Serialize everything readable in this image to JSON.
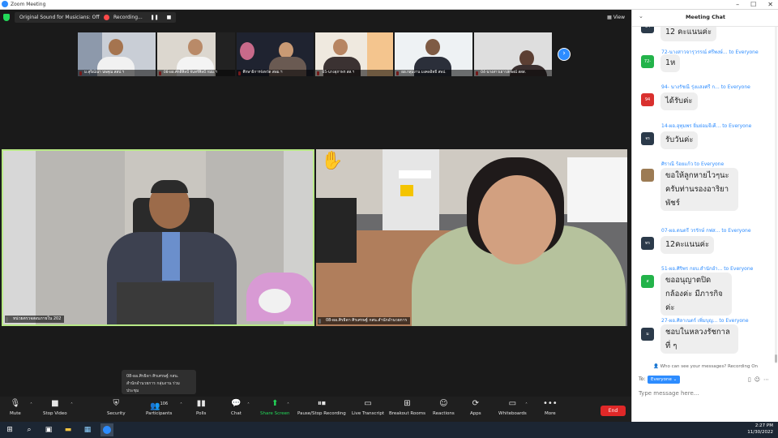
{
  "window": {
    "title": "Zoom Meeting",
    "minimize": "–",
    "maximize": "☐",
    "close": "✕"
  },
  "topbar": {
    "sound_label": "Original Sound for Musicians: Off",
    "recording_label": "Recording...",
    "pause_glyph": "❚❚",
    "stop_glyph": "■",
    "view_label": "View"
  },
  "strip": {
    "next_glyph": "›",
    "thumbs": [
      {
        "name": "ม.สุจิณ์ณา นพคุณ สสป.ฯ"
      },
      {
        "name": "08-ผอ.ศักดิ์ศิลป์ จันทร์ศิลป์ กมม.ฯ"
      },
      {
        "name": "ศึกษาธิการจังหวัด สพม.ฯ"
      },
      {
        "name": "05-นางสุภาพร สส.ฯ"
      },
      {
        "name": "ผอ.กลุ่มงาน มงคลอิทธิ์ สพป."
      },
      {
        "name": "04-นางสาวเยาวลักษณ์ สสส."
      }
    ]
  },
  "main_tiles": {
    "left_name": "หน่วยตรวจสอบภายใน 202",
    "right_name": "08-ผอ.ศิรธิดา ศิรเศรษฐ์ กสน.สำนักอำนวยการ"
  },
  "popup": {
    "line1": "08-ผอ.ศิรธิดา ศิรเศรษฐ์ กสน.",
    "line2": "สำนักอำนวยการ กลุ่มงาน ร่วมประชุม"
  },
  "toolbar": {
    "mute": "Mute",
    "stop_video": "Stop Video",
    "security": "Security",
    "participants": "Participants",
    "participants_count": "106",
    "polls": "Polls",
    "chat": "Chat",
    "share_screen": "Share Screen",
    "pause_stop_recording": "Pause/Stop Recording",
    "live_transcript": "Live Transcript",
    "breakout_rooms": "Breakout Rooms",
    "reactions": "Reactions",
    "apps": "Apps",
    "whiteboards": "Whiteboards",
    "more": "More",
    "end": "End"
  },
  "chat": {
    "header_collapse": "⌄",
    "title": "Meeting Chat",
    "messages": [
      {
        "avatar": "ลำ",
        "sender": "",
        "to": "",
        "text": "12 คะแนนค่ะ"
      },
      {
        "avatar": "72-",
        "sender": "72-นางสาวจารุวรรณ์ ศรีพงษ์...",
        "to": "to Everyone",
        "text": "1ห"
      },
      {
        "avatar": "94",
        "sender": "94- นางรัชณี รุ่งแสงศรี ก...",
        "to": "to Everyone",
        "text": "ได้รับค่ะ"
      },
      {
        "avatar": "จร",
        "sender": "14-ผอ.อุทุมพร ยิ่มย่อมจีเคี...",
        "to": "to Everyone",
        "text": "รับวันค่ะ"
      },
      {
        "avatar": "",
        "sender": "ศิราณี ร้อยแก้ว",
        "to": "to Everyone",
        "text": "ขอให้ลูกหายไวๆนะครับท่านรองอาริยาพัชร์"
      },
      {
        "avatar": "ทร",
        "sender": "07-ผอ.ดนตรี วรรักษ์ กฟส...",
        "to": "to Everyone",
        "text": "12คะแนนค่ะ"
      },
      {
        "avatar": "ส",
        "sender": "51-ผอ.ศิริพร กยบ.สำนักอำ...",
        "to": "to Everyone",
        "text": "ขออนุญาตปิดกล้องค่ะ มีภารกิจค่ะ"
      },
      {
        "avatar": "ม",
        "sender": "27-ผอ.ศิลาเนตร์ เพิ่มบุญ...",
        "to": "to Everyone",
        "text": "ชอบในหลวงรัชกาลที่ ๆ"
      }
    ],
    "note": "Who can see your messages? Recording On",
    "to_label": "To:",
    "to_value": "Everyone ⌄",
    "input_placeholder": "Type message here..."
  },
  "taskbar": {
    "time": "2:27 PM",
    "date": "11/30/2022"
  }
}
